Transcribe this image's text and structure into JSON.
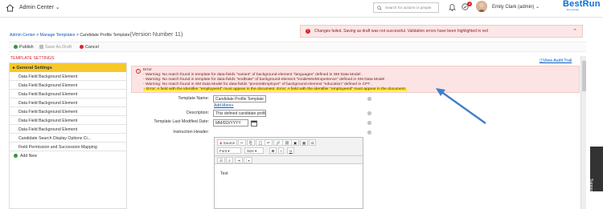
{
  "header": {
    "app_switcher": "Admin Center ⌄",
    "search_placeholder": "Search for actions or people",
    "notification_count": "4",
    "user_name": "Emily Clark (admin) ⌄",
    "brand": "BestRun",
    "brand_sub": "Run simple"
  },
  "breadcrumb": {
    "items": [
      "Admin Center",
      "Manage Templates"
    ],
    "separator": " > ",
    "current": "Candidate Profile Template",
    "version": "(Version Number 11)"
  },
  "banner": {
    "message": "Changes failed. Saving as draft was not successful. Validation errors have been highlighted in red"
  },
  "toolbar": {
    "publish": "Publish",
    "save_as_draft": "Save As Draft",
    "cancel": "Cancel"
  },
  "settings_title": "TEMPLATE SETTINGS",
  "sidebar": {
    "header": "General Settings",
    "items": [
      "Data Field Background Element",
      "Data Field Background Element",
      "Data Field Background Element",
      "Data Field Background Element",
      "Data Field Background Element",
      "Data Field Background Element",
      "Data Field Background Element",
      "Candidate Search Display Options Ci...",
      "Field Permission and Succession Mapping"
    ],
    "add_new": "Add New"
  },
  "audit_trail": "View Audit Trail",
  "error": {
    "title": "Error",
    "lines": [
      "- Warning: No match found in template for data-fields \"variant\" of background-element \"languages\" defined in SM Data Model .",
      "- Warning: No match found in template for data-fields \"endDate\" of background-element \"insideWorkExperience\" defined in SM Data Model .",
      "- Warning: No match found in SM Data Model for data-fields \"presentEmployer\" of background-element \"education\" defined in CPT ."
    ],
    "highlight": "- Error: A field with the identifier \"employeeId\" must appear in the document. Error: A field with the identifier \"employeeId\" must appear in the document."
  },
  "form": {
    "template_name_label": "Template Name:",
    "template_name_value": "Candidate Profile Template",
    "add_more": "Add More+",
    "description_label": "Description:",
    "description_value": "This defined candidate profile",
    "modified_label": "Template Last Modified Date:",
    "modified_value": "MM/DD/YYYY",
    "instruction_label": "Instruction Header:"
  },
  "editor": {
    "source": "Source",
    "font": "Font",
    "size": "Size",
    "bold": "B",
    "italic": "I",
    "underline": "U",
    "body_text": "Test"
  },
  "support": "Support",
  "colors": {
    "accent_yellow": "#f7c829",
    "error_red": "#d9222a",
    "link_blue": "#0a5bbd",
    "arrow_blue": "#3f7fc6"
  }
}
